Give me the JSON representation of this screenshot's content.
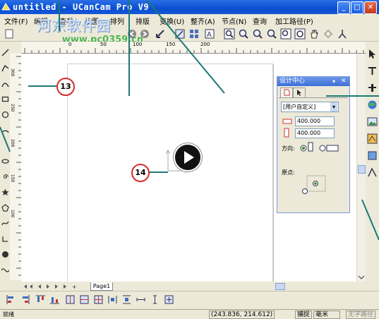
{
  "window": {
    "title": "untitled - UCanCam Pro V9"
  },
  "menu": {
    "items": [
      {
        "label": "文件(F)"
      },
      {
        "label": "编辑"
      },
      {
        "label": "查看"
      },
      {
        "label": "绘图"
      },
      {
        "label": "排列"
      },
      {
        "label": "排版"
      },
      {
        "label": "变换(U)"
      },
      {
        "label": "整齐(A)"
      },
      {
        "label": "节点(N)"
      },
      {
        "label": "查询"
      },
      {
        "label": "加工路径(P)"
      }
    ]
  },
  "watermark": {
    "text": "河东软件园",
    "url": "www.pc0359.cn"
  },
  "ruler": {
    "top_labels": [
      "0",
      "50",
      "100",
      "150",
      "200"
    ],
    "left_labels": [
      "300",
      "250",
      "200",
      "150",
      "100"
    ]
  },
  "canvas": {
    "page_tab": "Page1"
  },
  "callouts": {
    "c13": "13",
    "c14": "14"
  },
  "design_panel": {
    "title": "设计中心",
    "preset": "[用户自定义]",
    "width": "400.000",
    "height": "400.000",
    "direction_label": "方向:",
    "origin_label": "原点:"
  },
  "status": {
    "coords": "(243.836, 214.612)",
    "snap_label": "捕捉",
    "unit_label": "毫米",
    "mode_label": "无字路径"
  },
  "colors": {
    "titlebar": "#0a4fd0",
    "callout_border": "#d92a2a",
    "annotation_line": "#1a7a75"
  }
}
